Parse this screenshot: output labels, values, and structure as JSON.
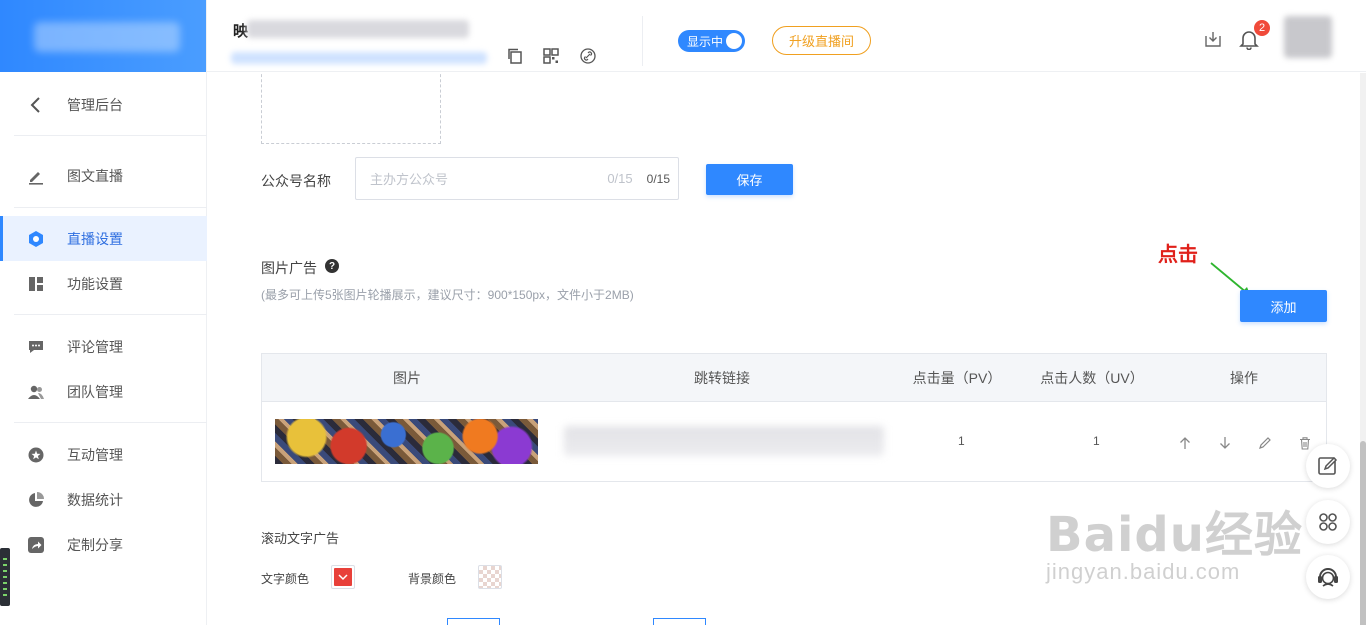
{
  "sidebar": {
    "back_label": "管理后台",
    "items": [
      {
        "label": "图文直播",
        "icon": "edit-icon"
      },
      {
        "label": "直播设置",
        "icon": "settings-hex-icon",
        "active": true
      },
      {
        "label": "功能设置",
        "icon": "layout-icon"
      },
      {
        "label": "评论管理",
        "icon": "comment-icon"
      },
      {
        "label": "团队管理",
        "icon": "team-icon"
      },
      {
        "label": "互动管理",
        "icon": "interaction-icon"
      },
      {
        "label": "数据统计",
        "icon": "pie-chart-icon"
      },
      {
        "label": "定制分享",
        "icon": "share-icon"
      }
    ]
  },
  "header": {
    "title_prefix": "映",
    "toggle_label": "显示中",
    "upgrade_label": "升级直播间",
    "notification_count": "2"
  },
  "form": {
    "account_label": "公众号名称",
    "account_placeholder": "主办方公众号",
    "account_counter": "0/15",
    "account_counter_bold": "0/15",
    "save_label": "保存"
  },
  "image_ad": {
    "title": "图片广告",
    "help": "?",
    "hint": "(最多可上传5张图片轮播展示，建议尺寸：900*150px，文件小于2MB)",
    "annotation": "点击",
    "add_label": "添加",
    "columns": [
      "图片",
      "跳转链接",
      "点击量（PV）",
      "点击人数（UV）",
      "操作"
    ],
    "rows": [
      {
        "pv": "1",
        "uv": "1"
      }
    ]
  },
  "scroll_ad": {
    "title": "滚动文字广告",
    "text_color_label": "文字颜色",
    "bg_color_label": "背景颜色",
    "text_color": "#e8403a"
  },
  "colors": {
    "primary": "#2f88ff",
    "warning": "#f0a020",
    "annotation": "#e0201a"
  },
  "watermark": {
    "brand": "Baidu经验",
    "url": "jingyan.baidu.com"
  }
}
